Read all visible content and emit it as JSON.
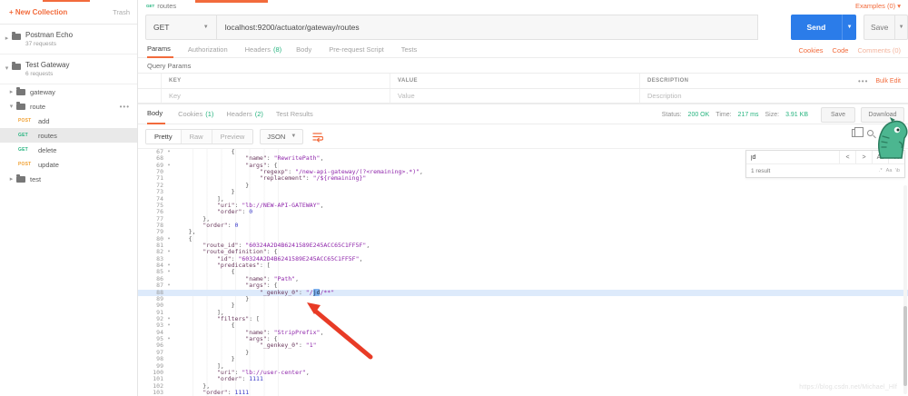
{
  "window": {
    "tab_method": "GET",
    "tab_title": "routes",
    "examples_label": "Examples (0)"
  },
  "colors": {
    "accent_orange": "#f26b3c",
    "send_blue": "#2b7ce9",
    "ok_green": "#26b47f",
    "key": "#6b3a5e",
    "string": "#8e24aa",
    "number": "#3a3ac8",
    "match_highlight": "#7fb3f0",
    "line_highlight": "#ddeafb",
    "arrow_red": "#e83b26"
  },
  "sidebar": {
    "new_collection": "+ New Collection",
    "trash": "Trash",
    "collections": [
      {
        "name": "Postman Echo",
        "meta": "37 requests",
        "caret": "▸"
      },
      {
        "name": "Test Gateway",
        "meta": "6 requests",
        "caret": "▾"
      }
    ],
    "tree": [
      {
        "type": "folder",
        "label": "gateway",
        "expanded": false
      },
      {
        "type": "folder",
        "label": "route",
        "expanded": true,
        "menu": "•••"
      },
      {
        "type": "request",
        "method": "POST",
        "label": "add"
      },
      {
        "type": "request",
        "method": "GET",
        "label": "routes",
        "selected": true
      },
      {
        "type": "request",
        "method": "GET",
        "label": "delete"
      },
      {
        "type": "request",
        "method": "POST",
        "label": "update"
      },
      {
        "type": "folder",
        "label": "test",
        "expanded": false
      }
    ]
  },
  "request": {
    "method": "GET",
    "url": "localhost:9200/actuator/gateway/routes",
    "send_label": "Send",
    "save_label": "Save",
    "tabs": [
      {
        "label": "Params",
        "count": ""
      },
      {
        "label": "Authorization",
        "count": ""
      },
      {
        "label": "Headers",
        "count": "(8)"
      },
      {
        "label": "Body",
        "count": ""
      },
      {
        "label": "Pre-request Script",
        "count": ""
      },
      {
        "label": "Tests",
        "count": ""
      }
    ],
    "links": {
      "cookies": "Cookies",
      "code": "Code",
      "comments": "Comments (0)"
    },
    "query_params": {
      "title": "Query Params",
      "columns": [
        "KEY",
        "VALUE",
        "DESCRIPTION"
      ],
      "menu": "•••",
      "bulk_edit": "Bulk Edit",
      "placeholders": [
        "Key",
        "Value",
        "Description"
      ]
    }
  },
  "response": {
    "tabs": [
      {
        "label": "Body",
        "count": ""
      },
      {
        "label": "Cookies",
        "count": "(1)"
      },
      {
        "label": "Headers",
        "count": "(2)"
      },
      {
        "label": "Test Results",
        "count": ""
      }
    ],
    "status_label": "Status:",
    "status_value": "200 OK",
    "time_label": "Time:",
    "time_value": "217 ms",
    "size_label": "Size:",
    "size_value": "3.91 KB",
    "save_label": "Save",
    "download_label": "Download",
    "view_modes": [
      "Pretty",
      "Raw",
      "Preview"
    ],
    "format": "JSON",
    "search": {
      "term": "jd",
      "result": "1 result",
      "prev": "<",
      "next": ">",
      "all": "All",
      "close": "X",
      "options": [
        ".*",
        "Aa",
        "\\b"
      ]
    },
    "code": {
      "lines": [
        {
          "n": 67,
          "f": true,
          "t": "                {"
        },
        {
          "n": 68,
          "f": false,
          "t": "                    \"name\": \"RewritePath\","
        },
        {
          "n": 69,
          "f": true,
          "t": "                    \"args\": {"
        },
        {
          "n": 70,
          "f": false,
          "t": "                        \"regexp\": \"/new-api-gateway/(?<remaining>.*)\","
        },
        {
          "n": 71,
          "f": false,
          "t": "                        \"replacement\": \"/${remaining}\""
        },
        {
          "n": 72,
          "f": false,
          "t": "                    }"
        },
        {
          "n": 73,
          "f": false,
          "t": "                }"
        },
        {
          "n": 74,
          "f": false,
          "t": "            ],"
        },
        {
          "n": 75,
          "f": false,
          "t": "            \"uri\": \"lb://NEW-API-GATEWAY\","
        },
        {
          "n": 76,
          "f": false,
          "t": "            \"order\": 0"
        },
        {
          "n": 77,
          "f": false,
          "t": "        },"
        },
        {
          "n": 78,
          "f": false,
          "t": "        \"order\": 0"
        },
        {
          "n": 79,
          "f": false,
          "t": "    },"
        },
        {
          "n": 80,
          "f": true,
          "t": "    {"
        },
        {
          "n": 81,
          "f": false,
          "t": "        \"route_id\": \"60324A2D4B6241589E245ACC65C1FF5F\","
        },
        {
          "n": 82,
          "f": true,
          "t": "        \"route_definition\": {"
        },
        {
          "n": 83,
          "f": false,
          "t": "            \"id\": \"60324A2D4B6241589E245ACC65C1FF5F\","
        },
        {
          "n": 84,
          "f": true,
          "t": "            \"predicates\": ["
        },
        {
          "n": 85,
          "f": true,
          "t": "                {"
        },
        {
          "n": 86,
          "f": false,
          "t": "                    \"name\": \"Path\","
        },
        {
          "n": 87,
          "f": true,
          "t": "                    \"args\": {"
        },
        {
          "n": 88,
          "f": false,
          "h": true,
          "t": "                        \"_genkey_0\": \"/jd/**\""
        },
        {
          "n": 89,
          "f": false,
          "t": "                    }"
        },
        {
          "n": 90,
          "f": false,
          "t": "                }"
        },
        {
          "n": 91,
          "f": false,
          "t": "            ],"
        },
        {
          "n": 92,
          "f": true,
          "t": "            \"filters\": ["
        },
        {
          "n": 93,
          "f": true,
          "t": "                {"
        },
        {
          "n": 94,
          "f": false,
          "t": "                    \"name\": \"StripPrefix\","
        },
        {
          "n": 95,
          "f": true,
          "t": "                    \"args\": {"
        },
        {
          "n": 96,
          "f": false,
          "t": "                        \"_genkey_0\": \"1\""
        },
        {
          "n": 97,
          "f": false,
          "t": "                    }"
        },
        {
          "n": 98,
          "f": false,
          "t": "                }"
        },
        {
          "n": 99,
          "f": false,
          "t": "            ],"
        },
        {
          "n": 100,
          "f": false,
          "t": "            \"uri\": \"lb://user-center\","
        },
        {
          "n": 101,
          "f": false,
          "t": "            \"order\": 1111"
        },
        {
          "n": 102,
          "f": false,
          "t": "        },"
        },
        {
          "n": 103,
          "f": false,
          "t": "        \"order\": 1111"
        }
      ]
    }
  },
  "watermark": "https://blog.csdn.net/Michael_Hlf"
}
